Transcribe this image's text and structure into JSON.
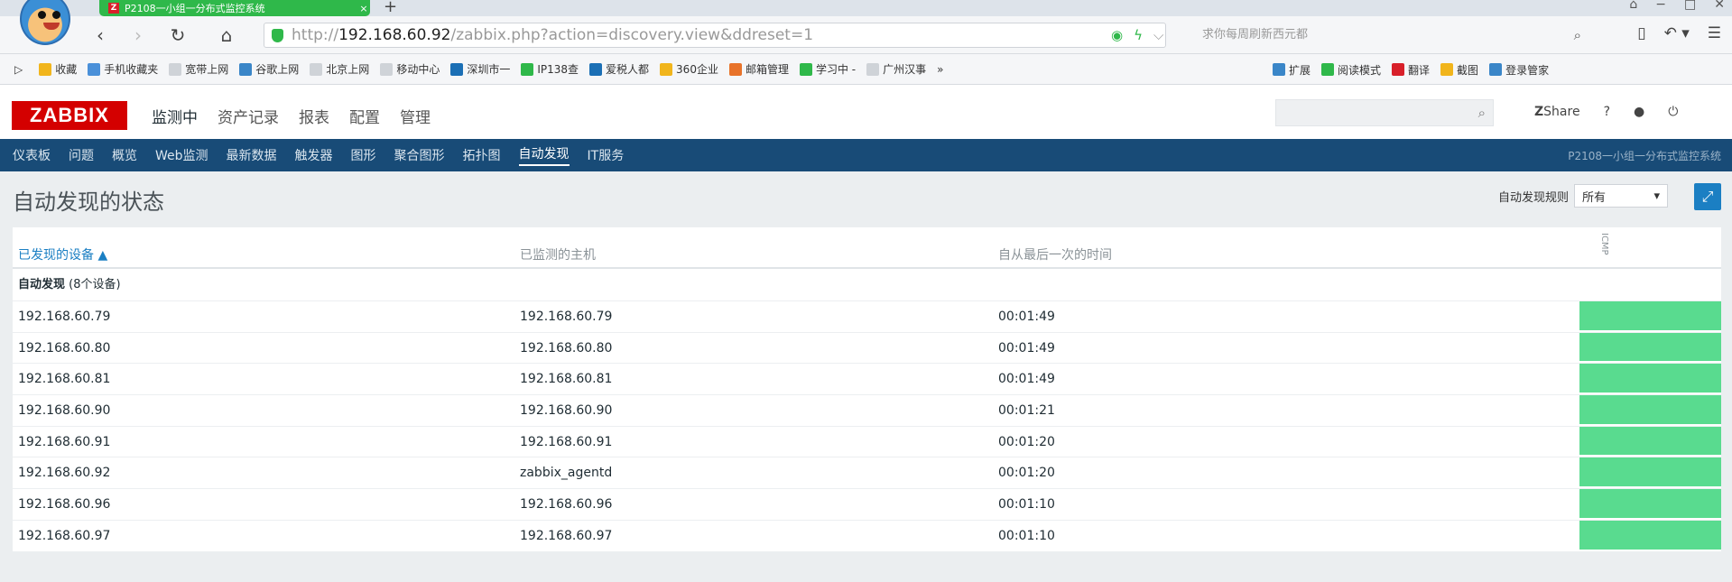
{
  "browser": {
    "tab_title": "P2108一小组一分布式监控系统",
    "tab_favicon": "Z",
    "url_prefix": "http://",
    "url_host": "192.168.60.92",
    "url_path": "/zabbix.php?action=discovery.view&ddreset=1",
    "search_placeholder": "求你每周刷新西元都",
    "bookmarks_left": [
      {
        "label": "收藏",
        "color": "#f1b51c"
      },
      {
        "label": "手机收藏夹",
        "color": "#4a90d9"
      },
      {
        "label": "宽带上网",
        "color": "#cfd3d8"
      },
      {
        "label": "谷歌上网",
        "color": "#3a86c8"
      },
      {
        "label": "北京上网",
        "color": "#cfd3d8"
      },
      {
        "label": "移动中心",
        "color": "#cfd3d8"
      },
      {
        "label": "深圳市一",
        "color": "#1b6fb5"
      },
      {
        "label": "IP138查",
        "color": "#2fb84a"
      },
      {
        "label": "爱税人都",
        "color": "#1b6fb5"
      },
      {
        "label": "360企业",
        "color": "#f1b51c"
      },
      {
        "label": "邮箱管理",
        "color": "#e8732a"
      },
      {
        "label": "学习中 -",
        "color": "#2fb84a"
      },
      {
        "label": "广州汉事",
        "color": "#cfd3d8"
      }
    ],
    "bookmarks_right": [
      {
        "label": "扩展",
        "color": "#3a86c8"
      },
      {
        "label": "阅读模式",
        "color": "#2fb84a"
      },
      {
        "label": "翻译",
        "color": "#d8202a"
      },
      {
        "label": "截图",
        "color": "#f1b51c"
      },
      {
        "label": "登录管家",
        "color": "#3a86c8"
      }
    ]
  },
  "zabbix": {
    "logo": "ZABBIX",
    "top_menu": [
      "监测中",
      "资产记录",
      "报表",
      "配置",
      "管理"
    ],
    "active_top": 0,
    "share_label": "Share",
    "help_label": "?",
    "sub_menu": [
      "仪表板",
      "问题",
      "概览",
      "Web监测",
      "最新数据",
      "触发器",
      "图形",
      "聚合图形",
      "拓扑图",
      "自动发现",
      "IT服务"
    ],
    "active_sub": 9,
    "server_name": "P2108一小组一分布式监控系统",
    "page_title": "自动发现的状态",
    "filter_label": "自动发现规则",
    "filter_value": "所有",
    "columns": [
      "已发现的设备 ▲",
      "已监测的主机",
      "自从最后一次的时间",
      "ICMP"
    ],
    "group": {
      "name": "自动发现",
      "count": "(8个设备)"
    },
    "rows": [
      {
        "device": "192.168.60.79",
        "host": "192.168.60.79",
        "uptime": "00:01:49"
      },
      {
        "device": "192.168.60.80",
        "host": "192.168.60.80",
        "uptime": "00:01:49"
      },
      {
        "device": "192.168.60.81",
        "host": "192.168.60.81",
        "uptime": "00:01:49"
      },
      {
        "device": "192.168.60.90",
        "host": "192.168.60.90",
        "uptime": "00:01:21"
      },
      {
        "device": "192.168.60.91",
        "host": "192.168.60.91",
        "uptime": "00:01:20"
      },
      {
        "device": "192.168.60.92",
        "host": "zabbix_agentd",
        "uptime": "00:01:20"
      },
      {
        "device": "192.168.60.96",
        "host": "192.168.60.96",
        "uptime": "00:01:10"
      },
      {
        "device": "192.168.60.97",
        "host": "192.168.60.97",
        "uptime": "00:01:10"
      }
    ],
    "status_color": "#59db8f"
  }
}
